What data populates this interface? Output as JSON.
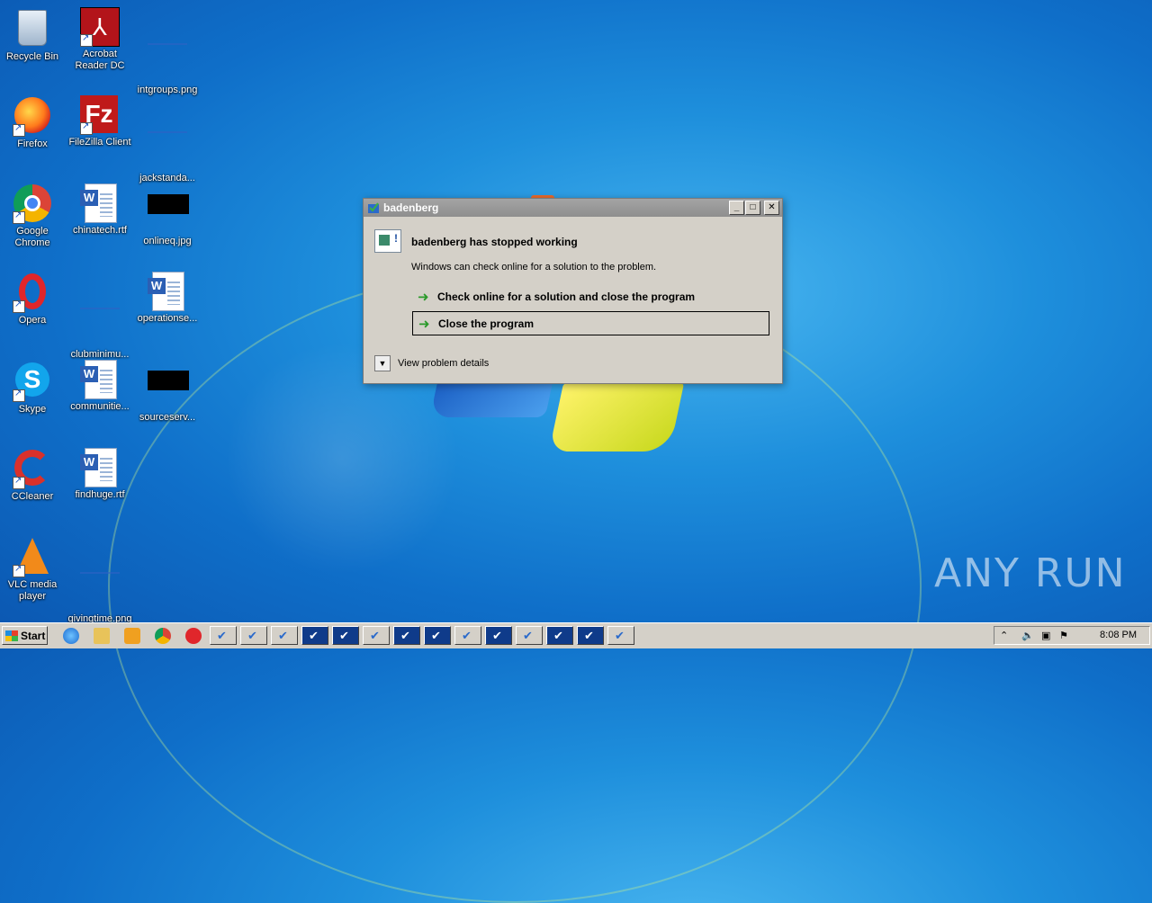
{
  "desktop": {
    "icons": [
      {
        "label": "Recycle Bin"
      },
      {
        "label": "Acrobat Reader DC"
      },
      {
        "label": "intgroups.png"
      },
      {
        "label": "Firefox"
      },
      {
        "label": "FileZilla Client"
      },
      {
        "label": "jackstanda..."
      },
      {
        "label": "Google Chrome"
      },
      {
        "label": "chinatech.rtf"
      },
      {
        "label": "onlineq.jpg"
      },
      {
        "label": "Opera"
      },
      {
        "label": "clubminimu..."
      },
      {
        "label": "operationse..."
      },
      {
        "label": "Skype"
      },
      {
        "label": "communitie..."
      },
      {
        "label": "sourceserv..."
      },
      {
        "label": "CCleaner"
      },
      {
        "label": "findhuge.rtf"
      },
      {
        "label": "VLC media player"
      },
      {
        "label": "givingtime.png"
      }
    ]
  },
  "dialog": {
    "title": "badenberg",
    "heading": "badenberg has stopped working",
    "message": "Windows can check online for a solution to the problem.",
    "options": [
      {
        "label": "Check online for a solution and close the program",
        "selected": false
      },
      {
        "label": "Close the program",
        "selected": true
      }
    ],
    "details_label": "View problem details",
    "title_buttons": {
      "minimize": "_",
      "maximize": "□",
      "close": "✕"
    }
  },
  "taskbar": {
    "start_label": "Start",
    "clock": "8:08 PM",
    "item_count": 14
  },
  "watermark": "ANY RUN"
}
